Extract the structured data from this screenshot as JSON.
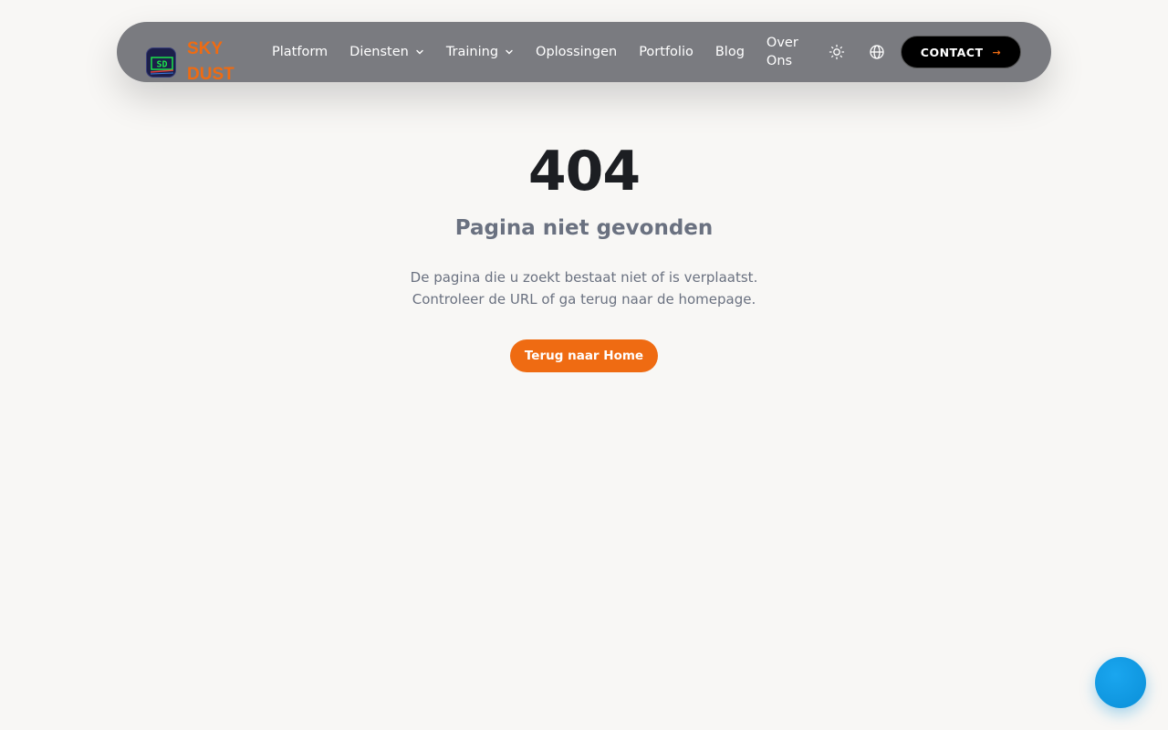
{
  "brand": {
    "logo_line1": "SKY",
    "logo_line2": "DUST",
    "badge_text": "SD",
    "logo_icon": "sd-logo-icon",
    "accent_color": "#ef6b12"
  },
  "nav": {
    "items": [
      {
        "label": "Platform",
        "dropdown": false
      },
      {
        "label": "Diensten",
        "dropdown": true
      },
      {
        "label": "Training",
        "dropdown": true
      },
      {
        "label": "Oplossingen",
        "dropdown": false
      },
      {
        "label": "Portfolio",
        "dropdown": false
      },
      {
        "label": "Blog",
        "dropdown": false
      },
      {
        "label": "Over Ons",
        "dropdown": false
      }
    ],
    "theme_icon": "sun-icon",
    "language_icon": "globe-icon",
    "contact_label": "CONTACT",
    "contact_arrow": "→"
  },
  "error": {
    "code": "404",
    "title": "Pagina niet gevonden",
    "description_line1": "De pagina die u zoekt bestaat niet of is verplaatst.",
    "description_line2": "Controleer de URL of ga terug naar de homepage.",
    "button_label": "Terug naar Home"
  },
  "fab": {
    "icon": "chat-bubble-icon",
    "color": "#0a8fd8"
  }
}
